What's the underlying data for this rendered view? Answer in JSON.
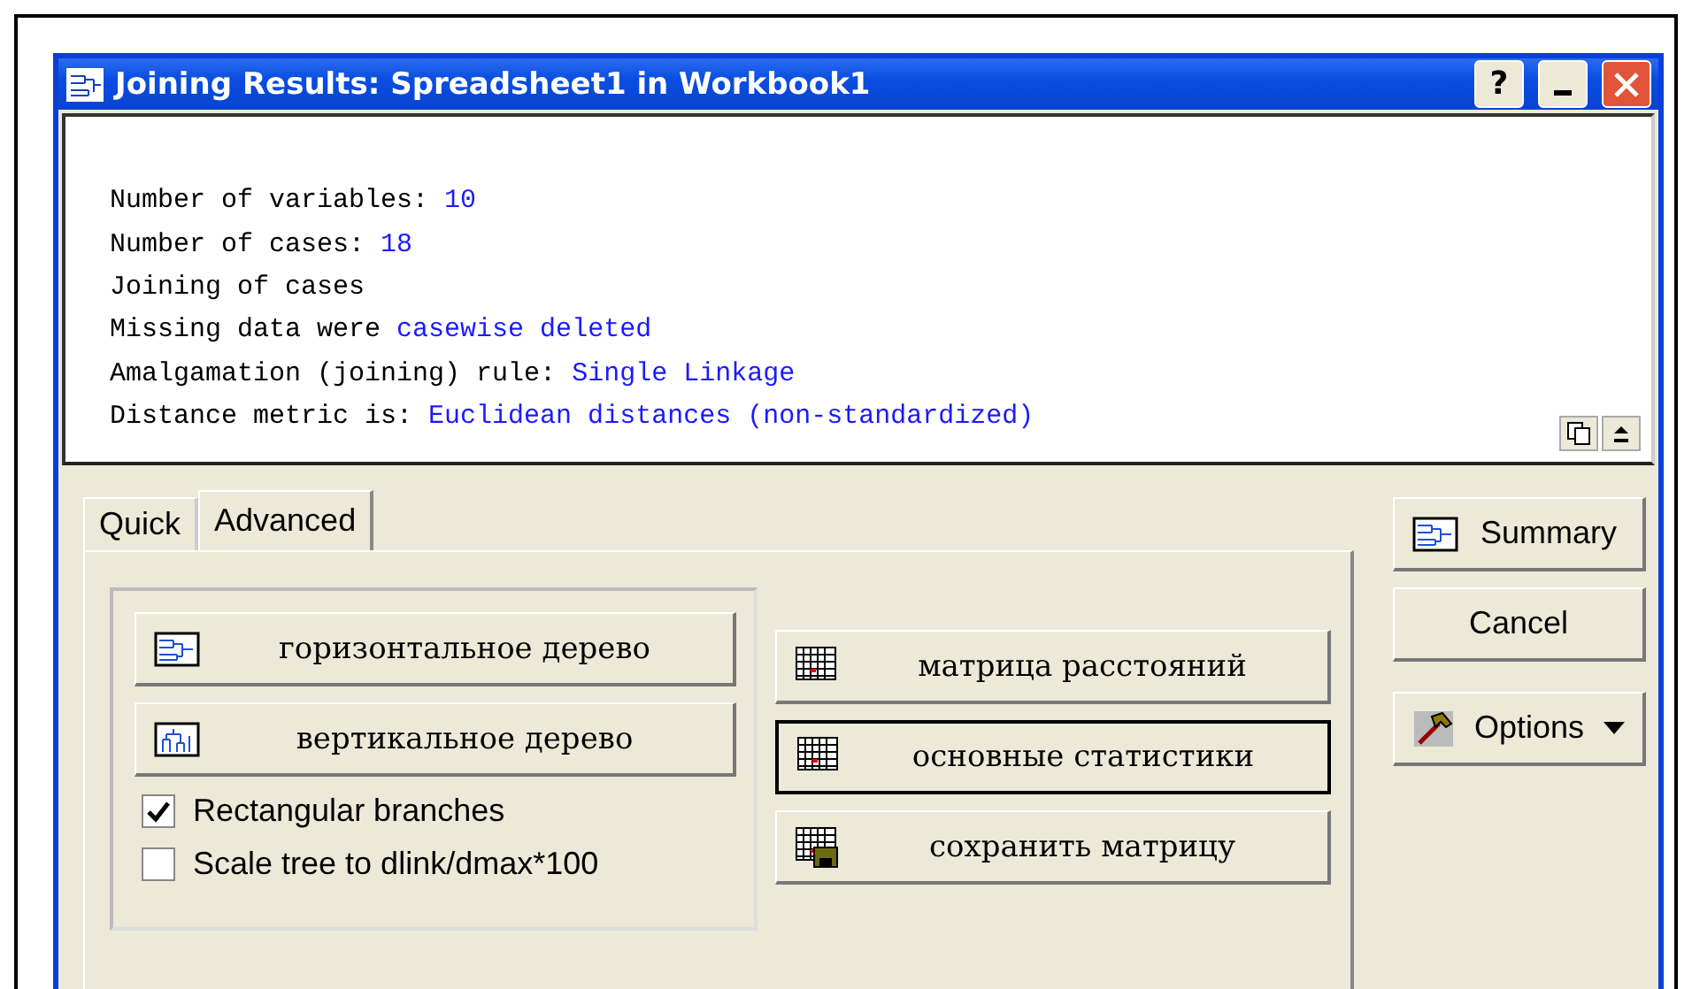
{
  "window": {
    "title": "Joining Results: Spreadsheet1 in Workbook1",
    "controls": [
      "?"
    ]
  },
  "output": [
    {
      "label": "Number of variables:",
      "value": "10"
    },
    {
      "label": "Number of cases:",
      "value": "18"
    },
    {
      "label": "Joining of cases"
    },
    {
      "label": "Missing data were",
      "value": "casewise deleted"
    },
    {
      "label": "Amalgamation (joining) rule:",
      "value": "Single Linkage"
    },
    {
      "label": "Distance metric is:",
      "value": "Euclidean distances (non-standardized)"
    }
  ],
  "tabs": [
    {
      "label": "Quick",
      "selected": false
    },
    {
      "label": "Advanced",
      "selected": true
    }
  ],
  "tree_buttons": [
    {
      "label": "горизонтальное дерево",
      "kind": "horizontal"
    },
    {
      "label": "вертикальное дерево",
      "kind": "vertical"
    }
  ],
  "checkboxes": [
    {
      "label": "Rectangular branches",
      "checked": true
    },
    {
      "label": "Scale tree to dlink/dmax*100",
      "checked": false
    }
  ],
  "matrix_buttons": [
    {
      "label": "матрица расстояний",
      "kind": "matrix",
      "default": false
    },
    {
      "label": "основные статистики",
      "kind": "matrix",
      "default": true
    },
    {
      "label": "сохранить матрицу",
      "kind": "save",
      "default": false
    }
  ],
  "side_buttons": [
    {
      "label": "Summary",
      "kind": "summary"
    },
    {
      "label": "Cancel",
      "kind": "plain"
    },
    {
      "label": "Options",
      "kind": "options"
    }
  ]
}
